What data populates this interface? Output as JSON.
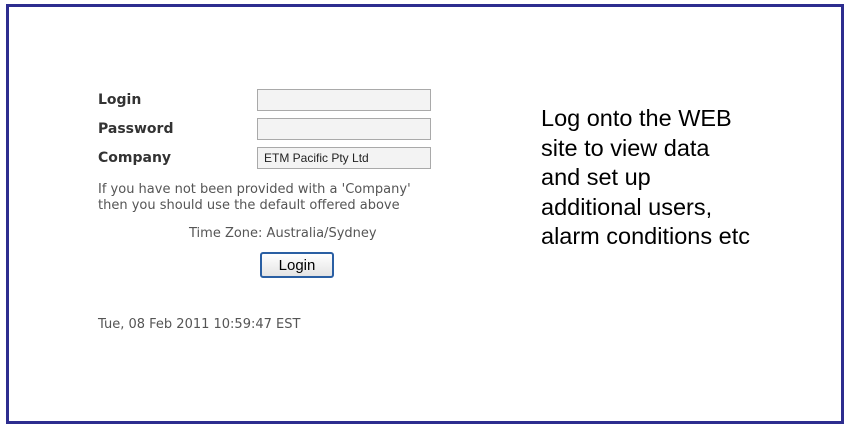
{
  "login_form": {
    "login_label": "Login",
    "login_value": "",
    "password_label": "Password",
    "password_value": "",
    "company_label": "Company",
    "company_value": "ETM Pacific Pty Ltd",
    "help_line1": "If you have not been provided with a 'Company'",
    "help_line2": "then you should use the default offered above",
    "timezone": "Time Zone: Australia/Sydney",
    "login_button": "Login",
    "timestamp": "Tue, 08 Feb 2011 10:59:47 EST"
  },
  "caption": {
    "lines": [
      "Log onto the WEB",
      "site to view data",
      "and set up",
      "additional users,",
      "alarm conditions etc"
    ]
  },
  "colors": {
    "frame_border": "#2d2d8f",
    "button_border": "#2a5fa3",
    "label_text": "#333333",
    "help_text": "#555555"
  }
}
